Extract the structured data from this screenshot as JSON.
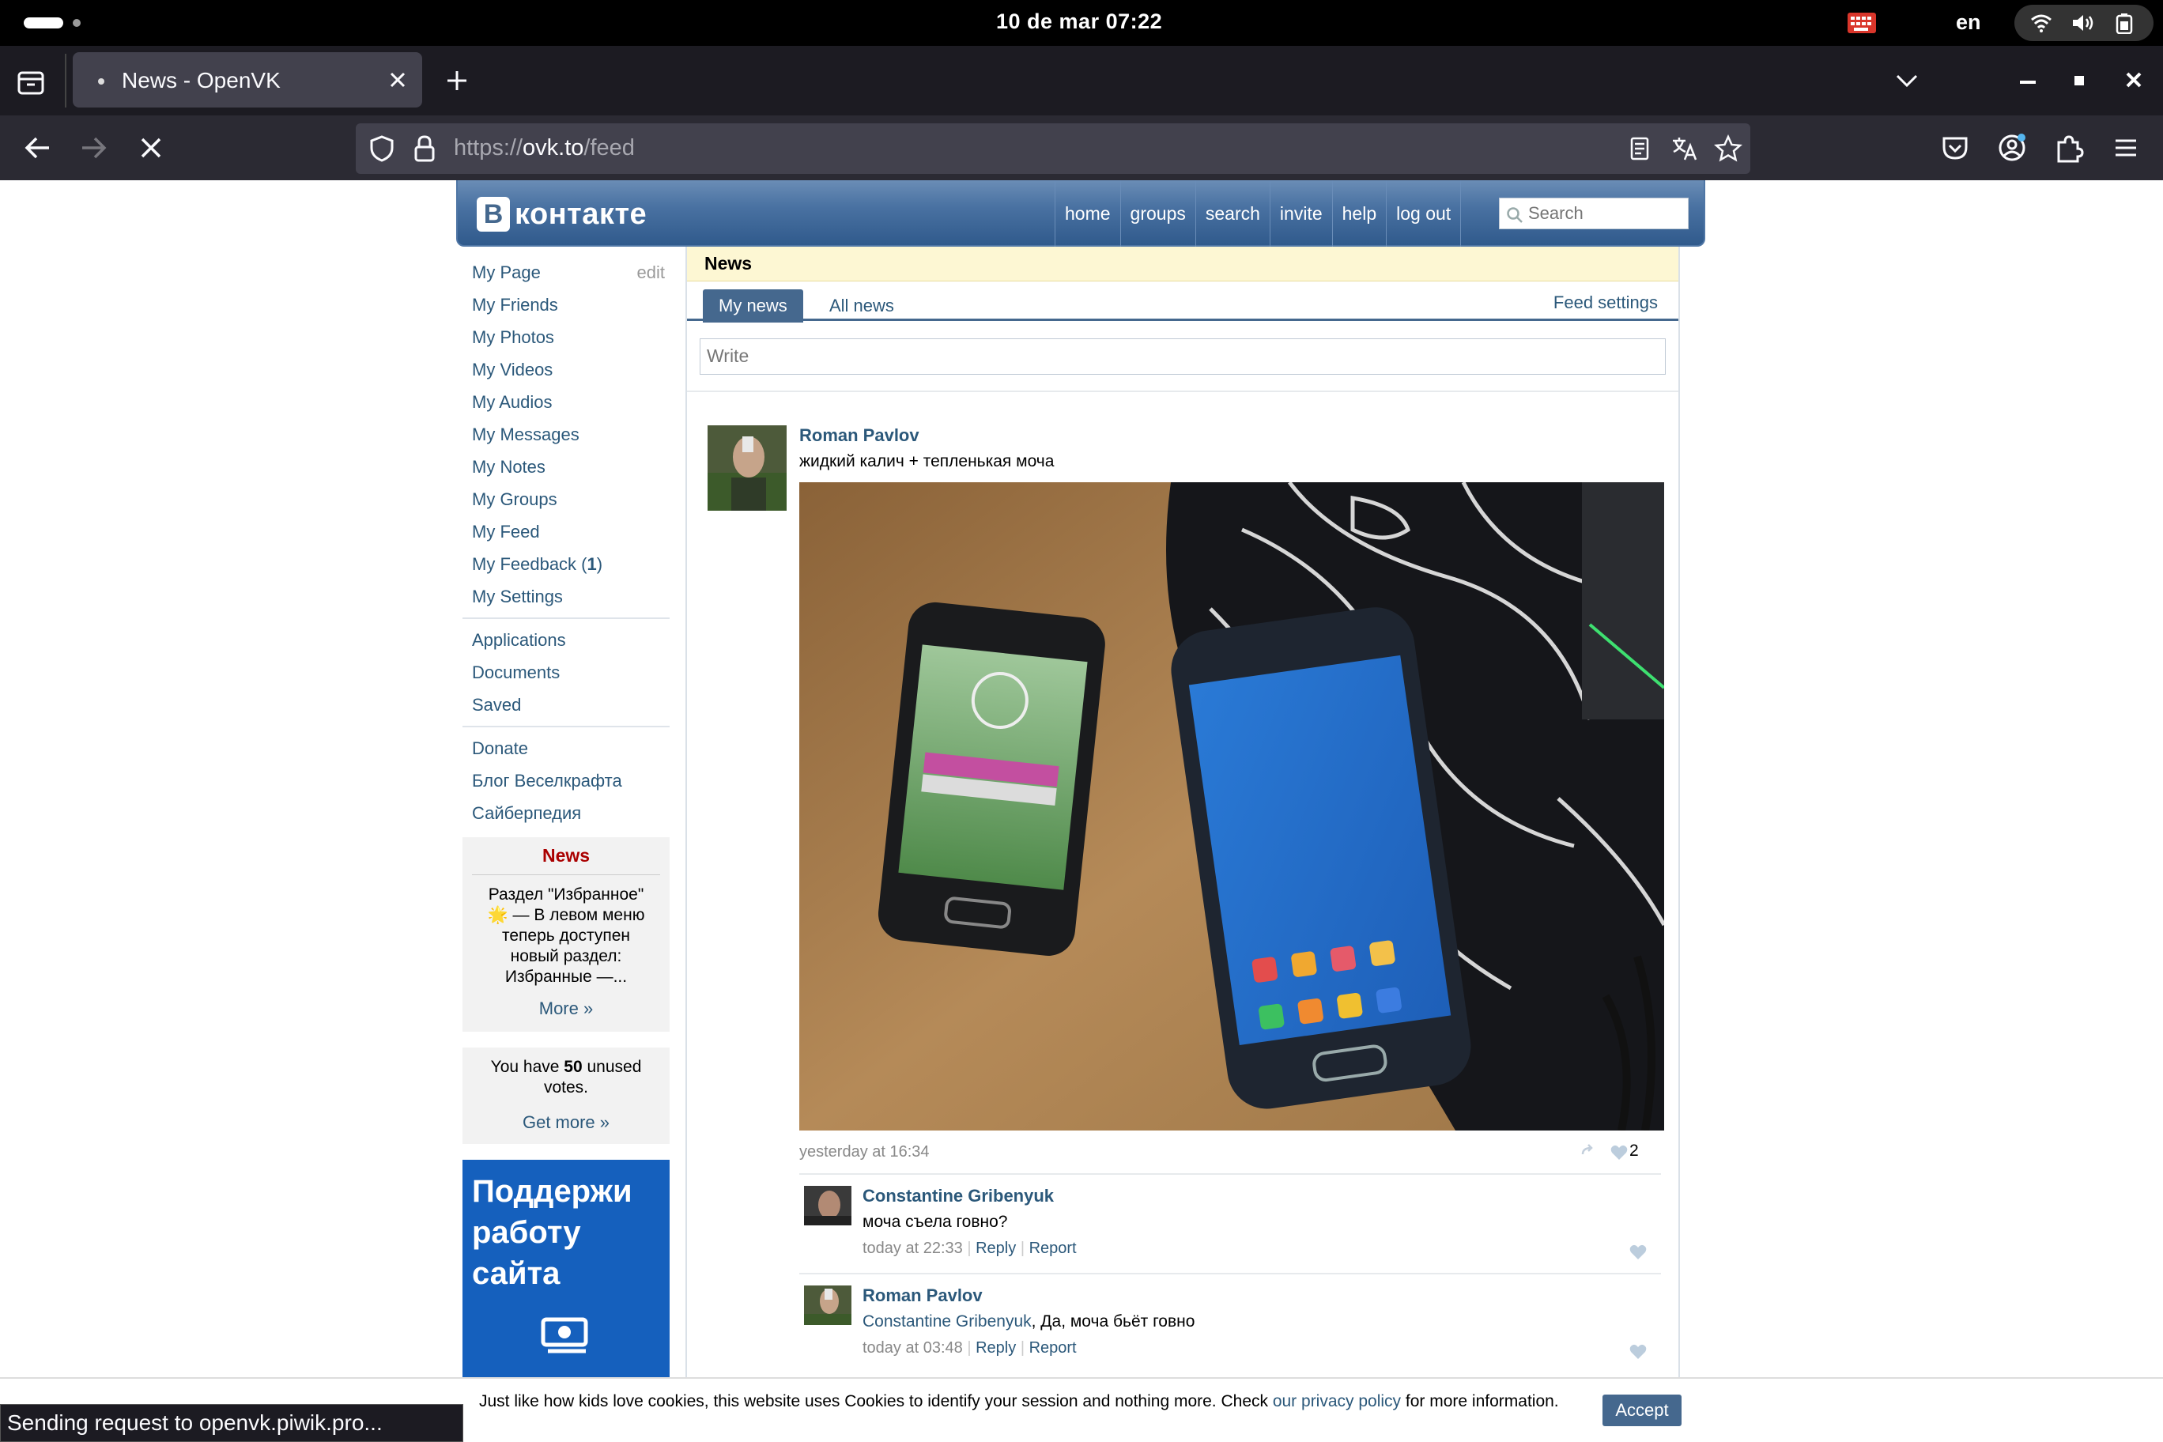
{
  "os": {
    "clock": "10 de mar  07:22",
    "lang": "en"
  },
  "browser": {
    "tab_title": "News - OpenVK",
    "url_scheme": "https://",
    "url_host": "ovk.to",
    "url_path": "/feed",
    "status_text": "Sending request to openvk.piwik.pro..."
  },
  "vk": {
    "logo_b": "В",
    "logo_word": "контакте",
    "nav": [
      "home",
      "groups",
      "search",
      "invite",
      "help",
      "log out"
    ],
    "search_placeholder": "Search"
  },
  "sidebar": {
    "my_page": "My Page",
    "edit": "edit",
    "menu": [
      "My Friends",
      "My Photos",
      "My Videos",
      "My Audios",
      "My Messages",
      "My Notes",
      "My Groups",
      "My Feed"
    ],
    "feedback_label": "My Feedback",
    "feedback_count": "1",
    "settings": "My Settings",
    "menu2": [
      "Applications",
      "Documents",
      "Saved"
    ],
    "menu3": [
      "Donate",
      "Блог Веселкрафта",
      "Сайберпедия"
    ],
    "news_box": {
      "title": "News",
      "body": "Раздел \"Избранное\" 🌟 — В левом меню теперь доступен новый раздел: Избранные —...",
      "more": "More »"
    },
    "votes": {
      "pre": "You have ",
      "count": "50",
      "post": " unused votes.",
      "more": "Get more »"
    },
    "banner": {
      "line1": "Поддержи",
      "line2": "работу",
      "line3": "сайта"
    }
  },
  "feed": {
    "section_title": "News",
    "tab_my": "My news",
    "tab_all": "All news",
    "feed_settings": "Feed settings",
    "write_placeholder": "Write",
    "post": {
      "author": "Roman Pavlov",
      "text": "жидкий калич + тепленькая моча",
      "time": "yesterday at 16:34",
      "likes": "2"
    },
    "comments": [
      {
        "author": "Constantine Gribenyuk",
        "mention": "",
        "text": "моча съела говно?",
        "time": "today at 22:33",
        "reply": "Reply",
        "report": "Report"
      },
      {
        "author": "Roman Pavlov",
        "mention": "Constantine Gribenyuk",
        "text": ", Да, моча бьёт говно",
        "time": "today at 03:48",
        "reply": "Reply",
        "report": "Report"
      }
    ]
  },
  "cookie": {
    "pre": "Just like how kids love cookies, this website uses Cookies to identify your session and nothing more. Check ",
    "link": "our privacy policy",
    "post": " for more information.",
    "accept": "Accept"
  },
  "colors": {
    "vk_blue": "#45688e",
    "link": "#2b587a",
    "browser_dark": "#1c1b22"
  }
}
